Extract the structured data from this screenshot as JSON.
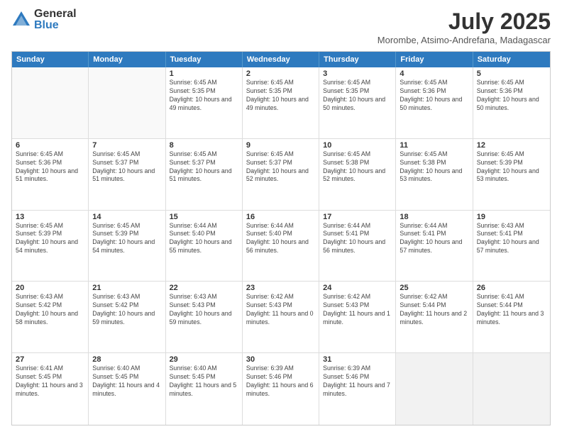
{
  "logo": {
    "general": "General",
    "blue": "Blue"
  },
  "title": "July 2025",
  "subtitle": "Morombe, Atsimo-Andrefana, Madagascar",
  "header_days": [
    "Sunday",
    "Monday",
    "Tuesday",
    "Wednesday",
    "Thursday",
    "Friday",
    "Saturday"
  ],
  "weeks": [
    [
      {
        "day": "",
        "info": ""
      },
      {
        "day": "",
        "info": ""
      },
      {
        "day": "1",
        "info": "Sunrise: 6:45 AM\nSunset: 5:35 PM\nDaylight: 10 hours and 49 minutes."
      },
      {
        "day": "2",
        "info": "Sunrise: 6:45 AM\nSunset: 5:35 PM\nDaylight: 10 hours and 49 minutes."
      },
      {
        "day": "3",
        "info": "Sunrise: 6:45 AM\nSunset: 5:35 PM\nDaylight: 10 hours and 50 minutes."
      },
      {
        "day": "4",
        "info": "Sunrise: 6:45 AM\nSunset: 5:36 PM\nDaylight: 10 hours and 50 minutes."
      },
      {
        "day": "5",
        "info": "Sunrise: 6:45 AM\nSunset: 5:36 PM\nDaylight: 10 hours and 50 minutes."
      }
    ],
    [
      {
        "day": "6",
        "info": "Sunrise: 6:45 AM\nSunset: 5:36 PM\nDaylight: 10 hours and 51 minutes."
      },
      {
        "day": "7",
        "info": "Sunrise: 6:45 AM\nSunset: 5:37 PM\nDaylight: 10 hours and 51 minutes."
      },
      {
        "day": "8",
        "info": "Sunrise: 6:45 AM\nSunset: 5:37 PM\nDaylight: 10 hours and 51 minutes."
      },
      {
        "day": "9",
        "info": "Sunrise: 6:45 AM\nSunset: 5:37 PM\nDaylight: 10 hours and 52 minutes."
      },
      {
        "day": "10",
        "info": "Sunrise: 6:45 AM\nSunset: 5:38 PM\nDaylight: 10 hours and 52 minutes."
      },
      {
        "day": "11",
        "info": "Sunrise: 6:45 AM\nSunset: 5:38 PM\nDaylight: 10 hours and 53 minutes."
      },
      {
        "day": "12",
        "info": "Sunrise: 6:45 AM\nSunset: 5:39 PM\nDaylight: 10 hours and 53 minutes."
      }
    ],
    [
      {
        "day": "13",
        "info": "Sunrise: 6:45 AM\nSunset: 5:39 PM\nDaylight: 10 hours and 54 minutes."
      },
      {
        "day": "14",
        "info": "Sunrise: 6:45 AM\nSunset: 5:39 PM\nDaylight: 10 hours and 54 minutes."
      },
      {
        "day": "15",
        "info": "Sunrise: 6:44 AM\nSunset: 5:40 PM\nDaylight: 10 hours and 55 minutes."
      },
      {
        "day": "16",
        "info": "Sunrise: 6:44 AM\nSunset: 5:40 PM\nDaylight: 10 hours and 56 minutes."
      },
      {
        "day": "17",
        "info": "Sunrise: 6:44 AM\nSunset: 5:41 PM\nDaylight: 10 hours and 56 minutes."
      },
      {
        "day": "18",
        "info": "Sunrise: 6:44 AM\nSunset: 5:41 PM\nDaylight: 10 hours and 57 minutes."
      },
      {
        "day": "19",
        "info": "Sunrise: 6:43 AM\nSunset: 5:41 PM\nDaylight: 10 hours and 57 minutes."
      }
    ],
    [
      {
        "day": "20",
        "info": "Sunrise: 6:43 AM\nSunset: 5:42 PM\nDaylight: 10 hours and 58 minutes."
      },
      {
        "day": "21",
        "info": "Sunrise: 6:43 AM\nSunset: 5:42 PM\nDaylight: 10 hours and 59 minutes."
      },
      {
        "day": "22",
        "info": "Sunrise: 6:43 AM\nSunset: 5:43 PM\nDaylight: 10 hours and 59 minutes."
      },
      {
        "day": "23",
        "info": "Sunrise: 6:42 AM\nSunset: 5:43 PM\nDaylight: 11 hours and 0 minutes."
      },
      {
        "day": "24",
        "info": "Sunrise: 6:42 AM\nSunset: 5:43 PM\nDaylight: 11 hours and 1 minute."
      },
      {
        "day": "25",
        "info": "Sunrise: 6:42 AM\nSunset: 5:44 PM\nDaylight: 11 hours and 2 minutes."
      },
      {
        "day": "26",
        "info": "Sunrise: 6:41 AM\nSunset: 5:44 PM\nDaylight: 11 hours and 3 minutes."
      }
    ],
    [
      {
        "day": "27",
        "info": "Sunrise: 6:41 AM\nSunset: 5:45 PM\nDaylight: 11 hours and 3 minutes."
      },
      {
        "day": "28",
        "info": "Sunrise: 6:40 AM\nSunset: 5:45 PM\nDaylight: 11 hours and 4 minutes."
      },
      {
        "day": "29",
        "info": "Sunrise: 6:40 AM\nSunset: 5:45 PM\nDaylight: 11 hours and 5 minutes."
      },
      {
        "day": "30",
        "info": "Sunrise: 6:39 AM\nSunset: 5:46 PM\nDaylight: 11 hours and 6 minutes."
      },
      {
        "day": "31",
        "info": "Sunrise: 6:39 AM\nSunset: 5:46 PM\nDaylight: 11 hours and 7 minutes."
      },
      {
        "day": "",
        "info": ""
      },
      {
        "day": "",
        "info": ""
      }
    ]
  ]
}
